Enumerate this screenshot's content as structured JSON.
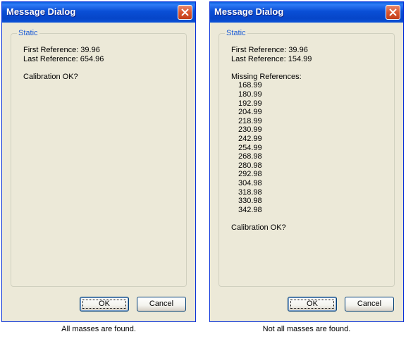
{
  "dialogs": [
    {
      "title": "Message Dialog",
      "group_label": "Static",
      "first_reference": "First Reference: 39.96",
      "last_reference": "Last Reference: 654.96",
      "calibration_prompt": "Calibration OK?",
      "ok_label": "OK",
      "cancel_label": "Cancel",
      "caption": "All masses are found."
    },
    {
      "title": "Message Dialog",
      "group_label": "Static",
      "first_reference": "First Reference: 39.96",
      "last_reference": "Last Reference: 154.99",
      "missing_heading": "Missing References:",
      "missing_references": [
        "168.99",
        "180.99",
        "192.99",
        "204.99",
        "218.99",
        "230.99",
        "242.99",
        "254.99",
        "268.98",
        "280.98",
        "292.98",
        "304.98",
        "318.98",
        "330.98",
        "342.98"
      ],
      "calibration_prompt": "Calibration OK?",
      "ok_label": "OK",
      "cancel_label": "Cancel",
      "caption": "Not all masses are found."
    }
  ],
  "colors": {
    "titlebar": "#0a4fd6",
    "dialog_bg": "#ece9d8",
    "group_label": "#1c5dd6",
    "close_button": "#d8562f"
  },
  "icons": {
    "close": "close-icon"
  }
}
